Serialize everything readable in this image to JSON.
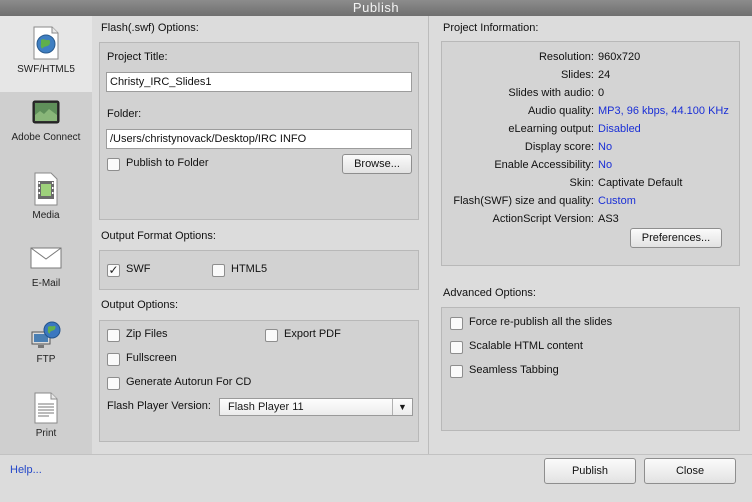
{
  "window": {
    "title": "Publish"
  },
  "sidebar": {
    "items": [
      {
        "label": "SWF/HTML5",
        "icon": "swf-globe-icon",
        "active": true
      },
      {
        "label": "Adobe Connect",
        "icon": "adobe-connect-icon",
        "active": false
      },
      {
        "label": "Media",
        "icon": "media-film-icon",
        "active": false
      },
      {
        "label": "E-Mail",
        "icon": "envelope-icon",
        "active": false
      },
      {
        "label": "FTP",
        "icon": "ftp-globe-computer-icon",
        "active": false
      },
      {
        "label": "Print",
        "icon": "print-document-icon",
        "active": false
      }
    ]
  },
  "flash_options": {
    "title": "Flash(.swf) Options:",
    "project_title_label": "Project Title:",
    "project_title_value": "Christy_IRC_Slides1",
    "folder_label": "Folder:",
    "folder_value": "/Users/christynovack/Desktop/IRC INFO",
    "publish_to_folder_label": "Publish to Folder",
    "publish_to_folder_checked": false,
    "browse_label": "Browse..."
  },
  "output_format": {
    "title": "Output Format Options:",
    "swf_label": "SWF",
    "swf_checked": true,
    "swf_mark": "✓",
    "html5_label": "HTML5",
    "html5_checked": false
  },
  "output_options": {
    "title": "Output Options:",
    "zip_label": "Zip Files",
    "export_pdf_label": "Export PDF",
    "fullscreen_label": "Fullscreen",
    "autorun_label": "Generate Autorun For CD",
    "player_version_label": "Flash Player Version:",
    "player_version_value": "Flash Player 11",
    "dropdown_arrow": "▼"
  },
  "project_info": {
    "title": "Project Information:",
    "rows": [
      {
        "key": "Resolution:",
        "value": "960x720",
        "link": false
      },
      {
        "key": "Slides:",
        "value": "24",
        "link": false
      },
      {
        "key": "Slides with audio:",
        "value": "0",
        "link": false
      },
      {
        "key": "Audio quality:",
        "value": "MP3, 96 kbps, 44.100 KHz",
        "link": true
      },
      {
        "key": "eLearning output:",
        "value": "Disabled",
        "link": true
      },
      {
        "key": "Display score:",
        "value": "No",
        "link": true
      },
      {
        "key": "Enable Accessibility:",
        "value": "No",
        "link": true
      },
      {
        "key": "Skin:",
        "value": "Captivate Default",
        "link": false
      },
      {
        "key": "Flash(SWF) size and quality:",
        "value": "Custom",
        "link": true
      },
      {
        "key": "ActionScript Version:",
        "value": "AS3",
        "link": false
      }
    ],
    "preferences_label": "Preferences..."
  },
  "advanced_options": {
    "title": "Advanced Options:",
    "items": [
      {
        "label": "Force re-publish all the slides",
        "checked": false
      },
      {
        "label": "Scalable HTML content",
        "checked": false
      },
      {
        "label": "Seamless Tabbing",
        "checked": false
      }
    ]
  },
  "footer": {
    "help_label": "Help...",
    "publish_label": "Publish",
    "close_label": "Close"
  },
  "colors": {
    "link": "#1a2fd6",
    "help_link": "#2347c9",
    "title_bar": "#7a7a7a"
  }
}
